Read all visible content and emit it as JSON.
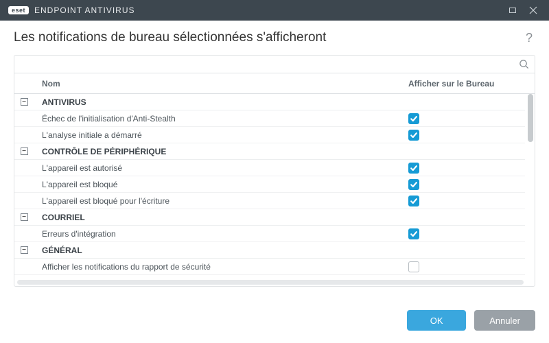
{
  "titlebar": {
    "brand": "eset",
    "product": "ENDPOINT ANTIVIRUS"
  },
  "header": {
    "title": "Les notifications de bureau sélectionnées s'afficheront"
  },
  "search": {
    "placeholder": ""
  },
  "columns": {
    "name": "Nom",
    "show": "Afficher sur le Bureau"
  },
  "groups": [
    {
      "label": "ANTIVIRUS",
      "items": [
        {
          "label": "Échec de l'initialisation d'Anti-Stealth",
          "checked": true
        },
        {
          "label": "L'analyse initiale a démarré",
          "checked": true
        }
      ]
    },
    {
      "label": "CONTRÔLE DE PÉRIPHÉRIQUE",
      "items": [
        {
          "label": "L'appareil est autorisé",
          "checked": true
        },
        {
          "label": "L'appareil est bloqué",
          "checked": true
        },
        {
          "label": "L'appareil est bloqué pour l'écriture",
          "checked": true
        }
      ]
    },
    {
      "label": "COURRIEL",
      "items": [
        {
          "label": "Erreurs d'intégration",
          "checked": true
        }
      ]
    },
    {
      "label": "GÉNÉRAL",
      "items": [
        {
          "label": "Afficher les notifications du rapport de sécurité",
          "checked": false
        }
      ]
    }
  ],
  "footer": {
    "ok": "OK",
    "cancel": "Annuler"
  }
}
